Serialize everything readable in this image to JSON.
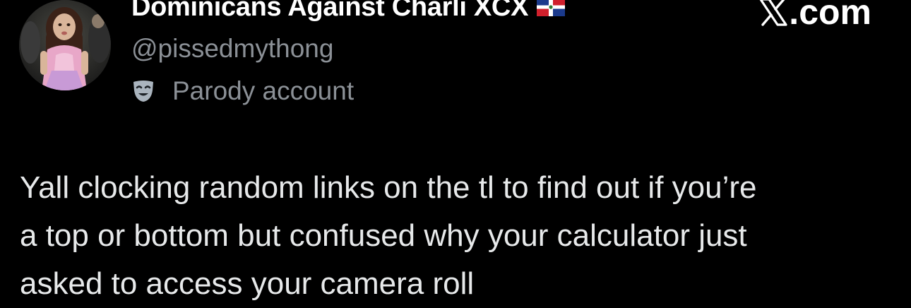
{
  "author": {
    "display_name": "Dominicans Against Charli XCX",
    "flag_icon": "dominican-republic-flag-icon",
    "handle": "@pissedmythong",
    "label_icon": "parody-mask-icon",
    "label": "Parody account"
  },
  "brand": {
    "logo_icon": "x-logo-icon",
    "text": ".com"
  },
  "tweet": {
    "lines": [
      "Yall clocking random links on the tl to find out if you’re",
      "a top or bottom but confused why your calculator just",
      "asked to access your camera roll"
    ]
  },
  "colors": {
    "background": "#000000",
    "name": "#ffffff",
    "secondary": "#8b9096",
    "body": "#e7e9ea"
  }
}
